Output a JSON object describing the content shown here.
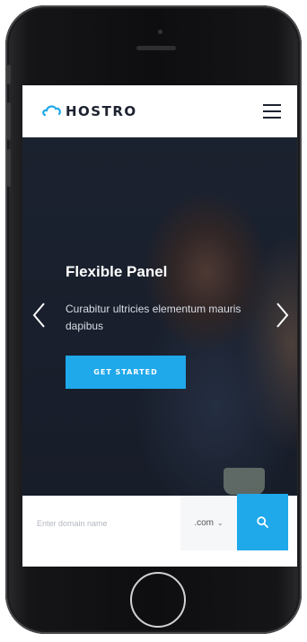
{
  "header": {
    "logo_text": "HOSTRO",
    "menu_icon": "hamburger-menu-icon"
  },
  "hero": {
    "title": "Flexible Panel",
    "subtitle": "Curabitur ultricies elementum mauris dapibus",
    "cta_label": "GET STARTED",
    "prev_icon": "chevron-left-icon",
    "next_icon": "chevron-right-icon"
  },
  "domain_search": {
    "placeholder": "Enter domain name",
    "tld_value": ".com",
    "search_icon": "search-icon"
  },
  "colors": {
    "accent": "#1fa8ea",
    "logo_dark": "#1d2230",
    "hero_text": "#ffffff"
  }
}
